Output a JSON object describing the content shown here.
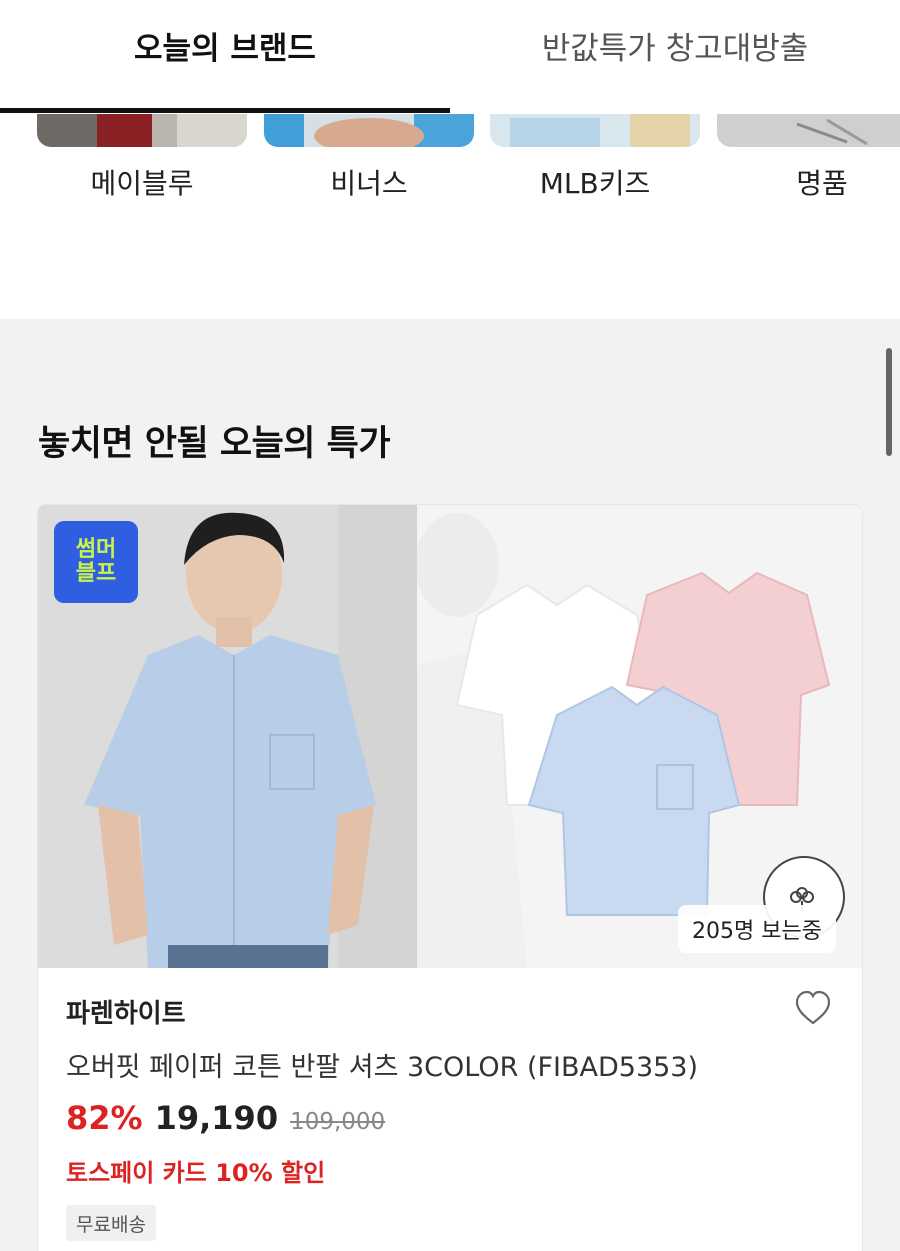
{
  "tabs": [
    {
      "label": "오늘의 브랜드",
      "active": true
    },
    {
      "label": "반값특가 창고대방출",
      "active": false
    }
  ],
  "brands": [
    {
      "label": "메이블루"
    },
    {
      "label": "비너스"
    },
    {
      "label": "MLB키즈"
    },
    {
      "label": "명품"
    }
  ],
  "section": {
    "title": "놓치면 안될 오늘의 특가"
  },
  "product": {
    "badge_lines": [
      "썸머",
      "블프"
    ],
    "viewers": "205명 보는중",
    "brand": "파렌하이트",
    "name": "오버핏 페이퍼 코튼 반팔 셔츠 3COLOR (FIBAD5353)",
    "discount": "82%",
    "price": "19,190",
    "original_price": "109,000",
    "promo": "토스페이 카드 10% 할인",
    "shipping_tag": "무료배송",
    "wishlist_icon": "heart-outline-icon",
    "certification_icon": "cotton-mark-icon"
  },
  "colors": {
    "accent_red": "#d22222",
    "badge_blue": "#2f5fe0",
    "badge_text": "#c9f24a"
  }
}
